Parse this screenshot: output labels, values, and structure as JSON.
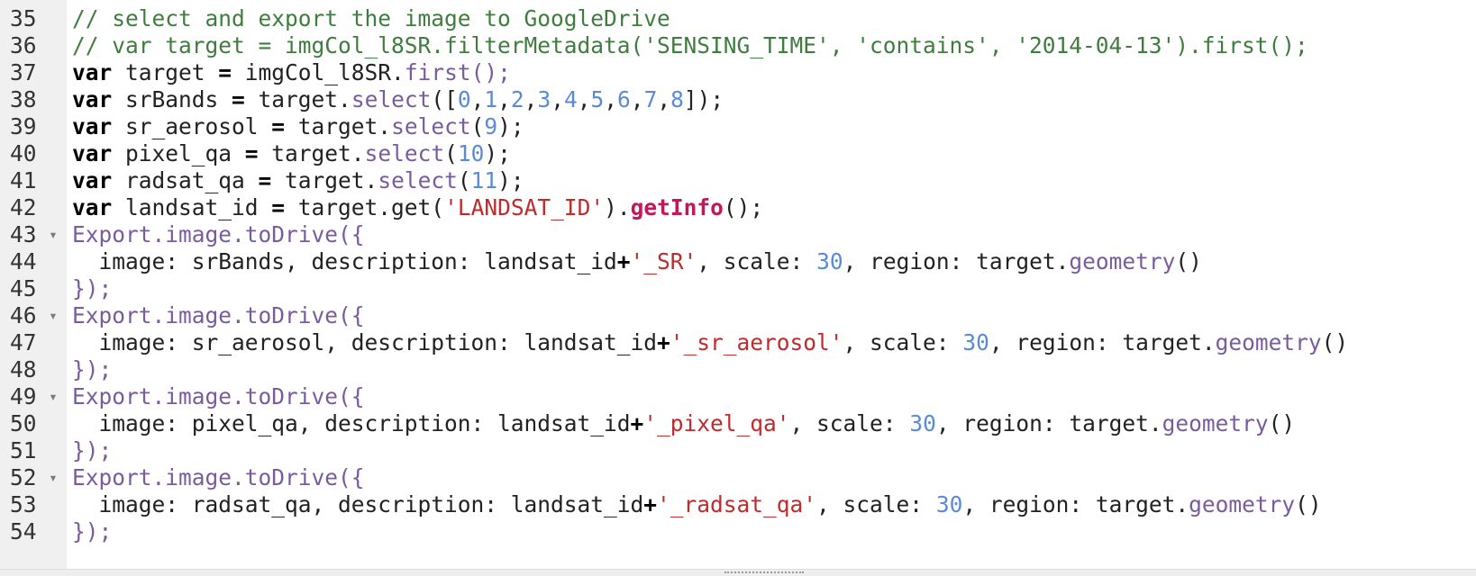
{
  "editor": {
    "lines": [
      {
        "num": "35",
        "fold": false,
        "tokens": [
          {
            "t": "comment",
            "v": "// select and export the image to GoogleDrive"
          }
        ]
      },
      {
        "num": "36",
        "fold": false,
        "tokens": [
          {
            "t": "comment",
            "v": "// var target = imgCol_l8SR.filterMetadata('SENSING_TIME', 'contains', '2014-04-13').first();"
          }
        ]
      },
      {
        "num": "37",
        "fold": false,
        "tokens": [
          {
            "t": "kw",
            "v": "var"
          },
          {
            "t": "plain",
            "v": " target "
          },
          {
            "t": "kw",
            "v": "="
          },
          {
            "t": "plain",
            "v": " imgCol_l8SR."
          },
          {
            "t": "method",
            "v": "first"
          },
          {
            "t": "method",
            "v": "();"
          }
        ]
      },
      {
        "num": "38",
        "fold": false,
        "tokens": [
          {
            "t": "kw",
            "v": "var"
          },
          {
            "t": "plain",
            "v": " srBands "
          },
          {
            "t": "kw",
            "v": "="
          },
          {
            "t": "plain",
            "v": " target."
          },
          {
            "t": "method",
            "v": "select"
          },
          {
            "t": "plain",
            "v": "(["
          },
          {
            "t": "num",
            "v": "0"
          },
          {
            "t": "plain",
            "v": ","
          },
          {
            "t": "num",
            "v": "1"
          },
          {
            "t": "plain",
            "v": ","
          },
          {
            "t": "num",
            "v": "2"
          },
          {
            "t": "plain",
            "v": ","
          },
          {
            "t": "num",
            "v": "3"
          },
          {
            "t": "plain",
            "v": ","
          },
          {
            "t": "num",
            "v": "4"
          },
          {
            "t": "plain",
            "v": ","
          },
          {
            "t": "num",
            "v": "5"
          },
          {
            "t": "plain",
            "v": ","
          },
          {
            "t": "num",
            "v": "6"
          },
          {
            "t": "plain",
            "v": ","
          },
          {
            "t": "num",
            "v": "7"
          },
          {
            "t": "plain",
            "v": ","
          },
          {
            "t": "num",
            "v": "8"
          },
          {
            "t": "plain",
            "v": "]);"
          }
        ]
      },
      {
        "num": "39",
        "fold": false,
        "tokens": [
          {
            "t": "kw",
            "v": "var"
          },
          {
            "t": "plain",
            "v": " sr_aerosol "
          },
          {
            "t": "kw",
            "v": "="
          },
          {
            "t": "plain",
            "v": " target."
          },
          {
            "t": "method",
            "v": "select"
          },
          {
            "t": "plain",
            "v": "("
          },
          {
            "t": "num",
            "v": "9"
          },
          {
            "t": "plain",
            "v": ");"
          }
        ]
      },
      {
        "num": "40",
        "fold": false,
        "tokens": [
          {
            "t": "kw",
            "v": "var"
          },
          {
            "t": "plain",
            "v": " pixel_qa "
          },
          {
            "t": "kw",
            "v": "="
          },
          {
            "t": "plain",
            "v": " target."
          },
          {
            "t": "method",
            "v": "select"
          },
          {
            "t": "plain",
            "v": "("
          },
          {
            "t": "num",
            "v": "10"
          },
          {
            "t": "plain",
            "v": ");"
          }
        ]
      },
      {
        "num": "41",
        "fold": false,
        "tokens": [
          {
            "t": "kw",
            "v": "var"
          },
          {
            "t": "plain",
            "v": " radsat_qa "
          },
          {
            "t": "kw",
            "v": "="
          },
          {
            "t": "plain",
            "v": " target."
          },
          {
            "t": "method",
            "v": "select"
          },
          {
            "t": "plain",
            "v": "("
          },
          {
            "t": "num",
            "v": "11"
          },
          {
            "t": "plain",
            "v": ");"
          }
        ]
      },
      {
        "num": "42",
        "fold": false,
        "tokens": [
          {
            "t": "kw",
            "v": "var"
          },
          {
            "t": "plain",
            "v": " landsat_id "
          },
          {
            "t": "kw",
            "v": "="
          },
          {
            "t": "plain",
            "v": " target.get("
          },
          {
            "t": "str",
            "v": "'LANDSAT_ID'"
          },
          {
            "t": "plain",
            "v": ")."
          },
          {
            "t": "strong",
            "v": "getInfo"
          },
          {
            "t": "plain",
            "v": "();"
          }
        ]
      },
      {
        "num": "43",
        "fold": true,
        "tokens": [
          {
            "t": "method",
            "v": "Export.image.toDrive({"
          }
        ]
      },
      {
        "num": "44",
        "fold": false,
        "tokens": [
          {
            "t": "plain",
            "v": "  image: srBands, description: landsat_id"
          },
          {
            "t": "kw",
            "v": "+"
          },
          {
            "t": "str",
            "v": "'_SR'"
          },
          {
            "t": "plain",
            "v": ", scale: "
          },
          {
            "t": "num",
            "v": "30"
          },
          {
            "t": "plain",
            "v": ", region: target."
          },
          {
            "t": "method",
            "v": "geometry"
          },
          {
            "t": "plain",
            "v": "()"
          }
        ]
      },
      {
        "num": "45",
        "fold": false,
        "tokens": [
          {
            "t": "method",
            "v": "});"
          }
        ]
      },
      {
        "num": "46",
        "fold": true,
        "tokens": [
          {
            "t": "method",
            "v": "Export.image.toDrive({"
          }
        ]
      },
      {
        "num": "47",
        "fold": false,
        "tokens": [
          {
            "t": "plain",
            "v": "  image: sr_aerosol, description: landsat_id"
          },
          {
            "t": "kw",
            "v": "+"
          },
          {
            "t": "str",
            "v": "'_sr_aerosol'"
          },
          {
            "t": "plain",
            "v": ", scale: "
          },
          {
            "t": "num",
            "v": "30"
          },
          {
            "t": "plain",
            "v": ", region: target."
          },
          {
            "t": "method",
            "v": "geometry"
          },
          {
            "t": "plain",
            "v": "()"
          }
        ]
      },
      {
        "num": "48",
        "fold": false,
        "tokens": [
          {
            "t": "method",
            "v": "});"
          }
        ]
      },
      {
        "num": "49",
        "fold": true,
        "tokens": [
          {
            "t": "method",
            "v": "Export.image.toDrive({"
          }
        ]
      },
      {
        "num": "50",
        "fold": false,
        "tokens": [
          {
            "t": "plain",
            "v": "  image: pixel_qa, description: landsat_id"
          },
          {
            "t": "kw",
            "v": "+"
          },
          {
            "t": "str",
            "v": "'_pixel_qa'"
          },
          {
            "t": "plain",
            "v": ", scale: "
          },
          {
            "t": "num",
            "v": "30"
          },
          {
            "t": "plain",
            "v": ", region: target."
          },
          {
            "t": "method",
            "v": "geometry"
          },
          {
            "t": "plain",
            "v": "()"
          }
        ]
      },
      {
        "num": "51",
        "fold": false,
        "tokens": [
          {
            "t": "method",
            "v": "});"
          }
        ]
      },
      {
        "num": "52",
        "fold": true,
        "tokens": [
          {
            "t": "method",
            "v": "Export.image.toDrive({"
          }
        ]
      },
      {
        "num": "53",
        "fold": false,
        "tokens": [
          {
            "t": "plain",
            "v": "  image: radsat_qa, description: landsat_id"
          },
          {
            "t": "kw",
            "v": "+"
          },
          {
            "t": "str",
            "v": "'_radsat_qa'"
          },
          {
            "t": "plain",
            "v": ", scale: "
          },
          {
            "t": "num",
            "v": "30"
          },
          {
            "t": "plain",
            "v": ", region: target."
          },
          {
            "t": "method",
            "v": "geometry"
          },
          {
            "t": "plain",
            "v": "()"
          }
        ]
      },
      {
        "num": "54",
        "fold": false,
        "tokens": [
          {
            "t": "method",
            "v": "});"
          }
        ]
      }
    ],
    "fold_glyph": "▾",
    "colors": {
      "comment": "#3f7d3f",
      "keyword": "#000000",
      "method": "#7a5c9e",
      "number": "#5a8ad8",
      "string": "#c02a2a",
      "strong": "#c2185b",
      "gutter": "#f0f0f0"
    }
  }
}
